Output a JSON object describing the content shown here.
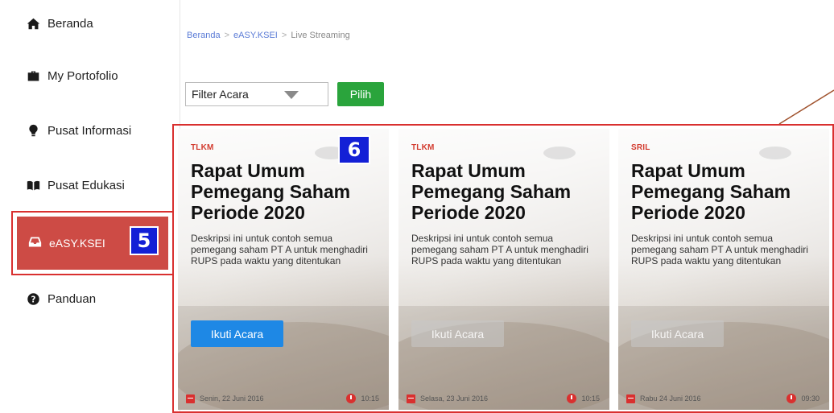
{
  "sidebar": {
    "items": [
      {
        "label": "Beranda",
        "icon": "home-icon"
      },
      {
        "label": "My Portofolio",
        "icon": "briefcase-icon"
      },
      {
        "label": "Pusat Informasi",
        "icon": "lightbulb-icon"
      },
      {
        "label": "Pusat Edukasi",
        "icon": "book-icon"
      },
      {
        "label": "eASY.KSEI",
        "icon": "inbox-icon",
        "active": true,
        "callout": "5"
      },
      {
        "label": "Panduan",
        "icon": "question-circle-icon"
      }
    ]
  },
  "breadcrumb": {
    "items": [
      "Beranda",
      "eASY.KSEI",
      "Live Streaming"
    ],
    "separator": ">"
  },
  "filter": {
    "select_value": "Filter Acara",
    "button_label": "Pilih"
  },
  "cards_callout": "6",
  "cards": [
    {
      "ticker": "TLKM",
      "title": "Rapat Umum Pemegang Saham Periode 2020",
      "description": "Deskripsi ini untuk contoh semua pemegang saham PT A untuk menghadiri RUPS pada waktu yang ditentukan",
      "button_label": "Ikuti Acara",
      "button_enabled": true,
      "date": "Senin, 22 Juni 2016",
      "time": "10:15"
    },
    {
      "ticker": "TLKM",
      "title": "Rapat Umum Pemegang Saham Periode 2020",
      "description": "Deskripsi ini untuk contoh semua pemegang saham PT A untuk menghadiri RUPS pada waktu yang ditentukan",
      "button_label": "Ikuti Acara",
      "button_enabled": false,
      "date": "Selasa, 23 Juni 2016",
      "time": "10:15"
    },
    {
      "ticker": "SRIL",
      "title": "Rapat Umum Pemegang Saham Periode 2020",
      "description": "Deskripsi ini untuk contoh semua pemegang saham PT A untuk menghadiri RUPS pada waktu yang ditentukan",
      "button_label": "Ikuti Acara",
      "button_enabled": false,
      "date": "Rabu 24 Juni 2016",
      "time": "09:30"
    }
  ],
  "colors": {
    "active_nav": "#cd4b45",
    "highlight_border": "#d9302f",
    "callout_badge": "#1320d6",
    "primary_button": "#1e88e5",
    "pilih_button": "#2aa43c",
    "ticker": "#d33b2f"
  }
}
